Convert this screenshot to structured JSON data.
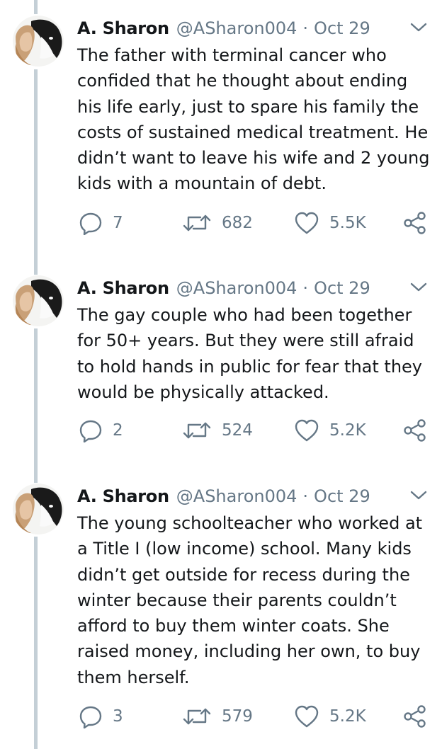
{
  "tweets": [
    {
      "name": "A. Sharon",
      "handle": "@ASharon004",
      "separator": "·",
      "date": "Oct 29",
      "text": "The father with terminal cancer who confided that he thought about ending his life early, just to spare his family the costs of sustained medical treatment. He didn’t want to leave his wife and 2 young kids with a mountain of debt.",
      "replies": "7",
      "retweets": "682",
      "likes": "5.5K"
    },
    {
      "name": "A. Sharon",
      "handle": "@ASharon004",
      "separator": "·",
      "date": "Oct 29",
      "text": "The gay couple who had been together for 50+ years. But they were still afraid to hold hands in public for fear that they would be physically attacked.",
      "replies": "2",
      "retweets": "524",
      "likes": "5.2K"
    },
    {
      "name": "A. Sharon",
      "handle": "@ASharon004",
      "separator": "·",
      "date": "Oct 29",
      "text": "The young schoolteacher who worked at a Title I (low income) school. Many kids didn’t get outside for recess during the winter because their parents couldn’t afford to buy them winter coats. She raised money, including her own, to buy them herself.",
      "replies": "3",
      "retweets": "579",
      "likes": "5.2K"
    }
  ],
  "icons": {
    "reply": "reply-icon",
    "retweet": "retweet-icon",
    "like": "heart-icon",
    "share": "share-icon",
    "menu": "chevron-down-icon"
  },
  "colors": {
    "text": "#14171a",
    "muted": "#657786",
    "thread_line": "#c4cfd6"
  }
}
